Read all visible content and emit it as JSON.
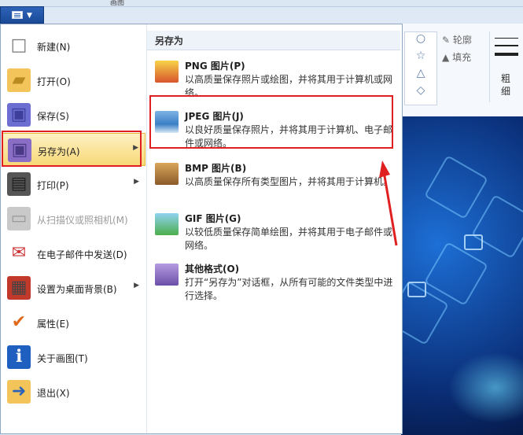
{
  "window": {
    "title_fragment": "画图"
  },
  "ribbon": {
    "outline_label": "轮廓",
    "fill_label": "填充",
    "size_label": "粗细",
    "shape_glyphs": [
      "○",
      "☆",
      "△",
      "◇"
    ]
  },
  "left_menu": {
    "items": [
      {
        "label": "新建(N)",
        "icon": "new-file-icon",
        "has_submenu": false,
        "disabled": false
      },
      {
        "label": "打开(O)",
        "icon": "open-folder-icon",
        "has_submenu": false,
        "disabled": false
      },
      {
        "label": "保存(S)",
        "icon": "save-disk-icon",
        "has_submenu": false,
        "disabled": false
      },
      {
        "label": "另存为(A)",
        "icon": "save-as-icon",
        "has_submenu": true,
        "disabled": false,
        "highlighted": true
      },
      {
        "label": "打印(P)",
        "icon": "printer-icon",
        "has_submenu": true,
        "disabled": false
      },
      {
        "label": "从扫描仪或照相机(M)",
        "icon": "scanner-icon",
        "has_submenu": false,
        "disabled": true
      },
      {
        "label": "在电子邮件中发送(D)",
        "icon": "email-icon",
        "has_submenu": false,
        "disabled": false
      },
      {
        "label": "设置为桌面背景(B)",
        "icon": "desktop-bg-icon",
        "has_submenu": true,
        "disabled": false
      },
      {
        "label": "属性(E)",
        "icon": "checkmark-icon",
        "has_submenu": false,
        "disabled": false
      },
      {
        "label": "关于画图(T)",
        "icon": "info-icon",
        "has_submenu": false,
        "disabled": false
      },
      {
        "label": "退出(X)",
        "icon": "exit-icon",
        "has_submenu": false,
        "disabled": false
      }
    ]
  },
  "save_as_panel": {
    "heading": "另存为",
    "options": [
      {
        "title": "PNG 图片(P)",
        "desc": "以高质量保存照片或绘图，并将其用于计算机或网络。",
        "icon": "png-image-icon"
      },
      {
        "title": "JPEG 图片(J)",
        "desc": "以良好质量保存照片，并将其用于计算机、电子邮件或网络。",
        "icon": "jpeg-image-icon",
        "boxed": true
      },
      {
        "title": "BMP 图片(B)",
        "desc": "以高质量保存所有类型图片，并将其用于计算机。",
        "icon": "bmp-image-icon"
      },
      {
        "title": "GIF 图片(G)",
        "desc": "以较低质量保存简单绘图，并将其用于电子邮件或网络。",
        "icon": "gif-image-icon"
      },
      {
        "title": "其他格式(O)",
        "desc": "打开“另存为”对话框，从所有可能的文件类型中进行选择。",
        "icon": "other-formats-icon"
      }
    ]
  },
  "colors": {
    "highlight_box": "#e02020",
    "menu_highlight": "#f8d978",
    "file_button": "#2d63b8"
  }
}
